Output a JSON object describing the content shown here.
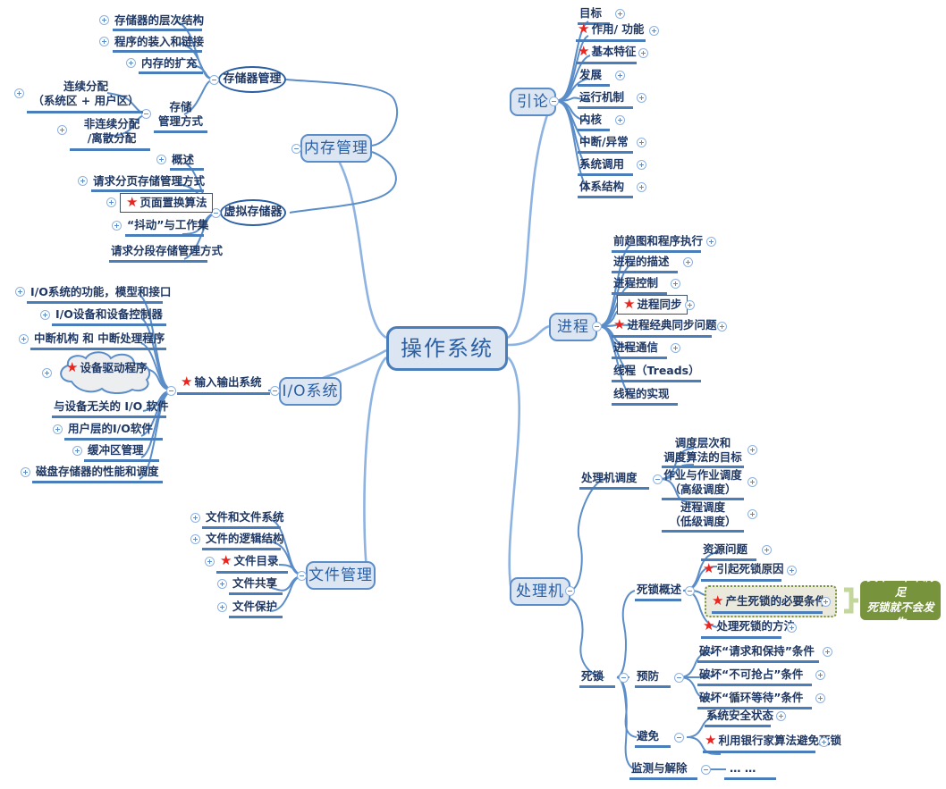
{
  "root": {
    "label": "操作系统"
  },
  "colors": {
    "node_fill": "#dce6f2",
    "node_border": "#5b8dc8",
    "text": "#1f3864",
    "root_text": "#2b5fa4",
    "branch_line": "#4a7ebb",
    "star": "#e8251f",
    "callout_fill": "#77933c",
    "callout_text": "#ffffff",
    "dotted_node_fill": "#ebe8dc",
    "dotted_node_border": "#77933c"
  },
  "icons": {
    "expand": "plus-circle-icon",
    "collapse": "minus-circle-icon",
    "star": "red-star-icon"
  },
  "branches": {
    "memory": {
      "label": "内存管理",
      "groups": [
        {
          "label": "存储器管理",
          "shape": "ellipse",
          "children": [
            {
              "label": "存储器的层次结构",
              "toggle": "expand"
            },
            {
              "label": "程序的装入和链接",
              "toggle": "expand"
            },
            {
              "label": "内存的扩充",
              "toggle": "expand"
            },
            {
              "label": "存储\n管理方式",
              "toggle": "collapse",
              "children": [
                {
                  "label": "连续分配\n（系统区 + 用户区）",
                  "toggle": "expand"
                },
                {
                  "label": "非连续分配\n/离散分配",
                  "toggle": "expand"
                }
              ]
            }
          ]
        },
        {
          "label": "虚拟存储器",
          "shape": "ellipse",
          "children": [
            {
              "label": "概述",
              "toggle": "expand"
            },
            {
              "label": "请求分页存储管理方式",
              "toggle": "expand"
            },
            {
              "label": "页面置换算法",
              "toggle": "expand",
              "star": true,
              "boxed": true
            },
            {
              "label": "“抖动”与工作集",
              "toggle": "expand"
            },
            {
              "label": "请求分段存储管理方式",
              "toggle": "none"
            }
          ]
        }
      ]
    },
    "io": {
      "label": "I/O系统",
      "groups": [
        {
          "label": "输入输出系统",
          "shape": "plain",
          "star": true,
          "toggle": "collapse",
          "children": [
            {
              "label": "I/O系统的功能，模型和接口",
              "toggle": "expand"
            },
            {
              "label": "I/O设备和设备控制器",
              "toggle": "expand"
            },
            {
              "label": "中断机构 和 中断处理程序",
              "toggle": "expand"
            },
            {
              "label": "设备驱动程序",
              "toggle": "expand",
              "star": true,
              "cloud": true
            },
            {
              "label": "与设备无关的 I/O 软件",
              "toggle": "none"
            },
            {
              "label": "用户层的I/O软件",
              "toggle": "expand"
            },
            {
              "label": "缓冲区管理",
              "toggle": "expand"
            },
            {
              "label": "磁盘存储器的性能和调度",
              "toggle": "expand"
            }
          ]
        }
      ]
    },
    "file": {
      "label": "文件管理",
      "children": [
        {
          "label": "文件和文件系统",
          "toggle": "expand"
        },
        {
          "label": "文件的逻辑结构",
          "toggle": "expand"
        },
        {
          "label": "文件目录",
          "toggle": "expand",
          "star": true
        },
        {
          "label": "文件共享",
          "toggle": "expand"
        },
        {
          "label": "文件保护",
          "toggle": "expand"
        }
      ]
    },
    "intro": {
      "label": "引论",
      "toggle": "collapse",
      "children": [
        {
          "label": "目标",
          "toggle": "expand"
        },
        {
          "label": "作用/ 功能",
          "toggle": "expand",
          "star": true
        },
        {
          "label": "基本特征",
          "toggle": "expand",
          "star": true
        },
        {
          "label": "发展",
          "toggle": "expand"
        },
        {
          "label": "运行机制",
          "toggle": "expand"
        },
        {
          "label": "内核",
          "toggle": "expand"
        },
        {
          "label": "中断/异常",
          "toggle": "expand"
        },
        {
          "label": "系统调用",
          "toggle": "expand"
        },
        {
          "label": "体系结构",
          "toggle": "expand"
        }
      ]
    },
    "process": {
      "label": "进程",
      "toggle": "collapse",
      "children": [
        {
          "label": "前趋图和程序执行",
          "toggle": "expand"
        },
        {
          "label": "进程的描述",
          "toggle": "expand"
        },
        {
          "label": "进程控制",
          "toggle": "expand"
        },
        {
          "label": "进程同步",
          "toggle": "expand",
          "star": true,
          "boxed": true
        },
        {
          "label": "进程经典同步问题",
          "toggle": "expand",
          "star": true
        },
        {
          "label": "进程通信",
          "toggle": "expand"
        },
        {
          "label": "线程（Treads）",
          "toggle": "none"
        },
        {
          "label": "线程的实现",
          "toggle": "none"
        }
      ]
    },
    "processor": {
      "label": "处理机",
      "toggle": "collapse",
      "groups": [
        {
          "label": "处理机调度",
          "toggle": "collapse",
          "children": [
            {
              "label": "调度层次和\n调度算法的目标",
              "toggle": "expand"
            },
            {
              "label": "作业与作业调度\n（高级调度）",
              "toggle": "expand"
            },
            {
              "label": "进程调度\n（低级调度）",
              "toggle": "expand"
            }
          ]
        },
        {
          "label": "死锁",
          "toggle": "collapse",
          "subgroups": [
            {
              "label": "死锁概述",
              "toggle": "collapse",
              "children": [
                {
                  "label": "资源问题",
                  "toggle": "expand"
                },
                {
                  "label": "引起死锁原因",
                  "toggle": "expand",
                  "star": true
                },
                {
                  "label": "产生死锁的必要条件",
                  "toggle": "expand",
                  "star": true,
                  "dotted": true,
                  "callout": "其中一个不满足\n死锁就不会发生"
                },
                {
                  "label": "处理死锁的方法",
                  "toggle": "expand",
                  "star": true
                }
              ]
            },
            {
              "label": "预防",
              "toggle": "collapse",
              "children": [
                {
                  "label": "破坏“请求和保持”条件",
                  "toggle": "expand"
                },
                {
                  "label": "破坏“不可抢占”条件",
                  "toggle": "expand"
                },
                {
                  "label": "破坏“循环等待”条件",
                  "toggle": "expand"
                }
              ]
            },
            {
              "label": "避免",
              "toggle": "collapse",
              "children": [
                {
                  "label": "系统安全状态",
                  "toggle": "expand"
                },
                {
                  "label": "利用银行家算法避免死锁",
                  "toggle": "expand",
                  "star": true
                }
              ]
            },
            {
              "label": "监测与解除",
              "toggle": "collapse",
              "children": [
                {
                  "label": "… …",
                  "toggle": "none"
                }
              ]
            }
          ]
        }
      ]
    }
  },
  "callout": {
    "text": "其中一个不满足\n死锁就不会发生"
  }
}
